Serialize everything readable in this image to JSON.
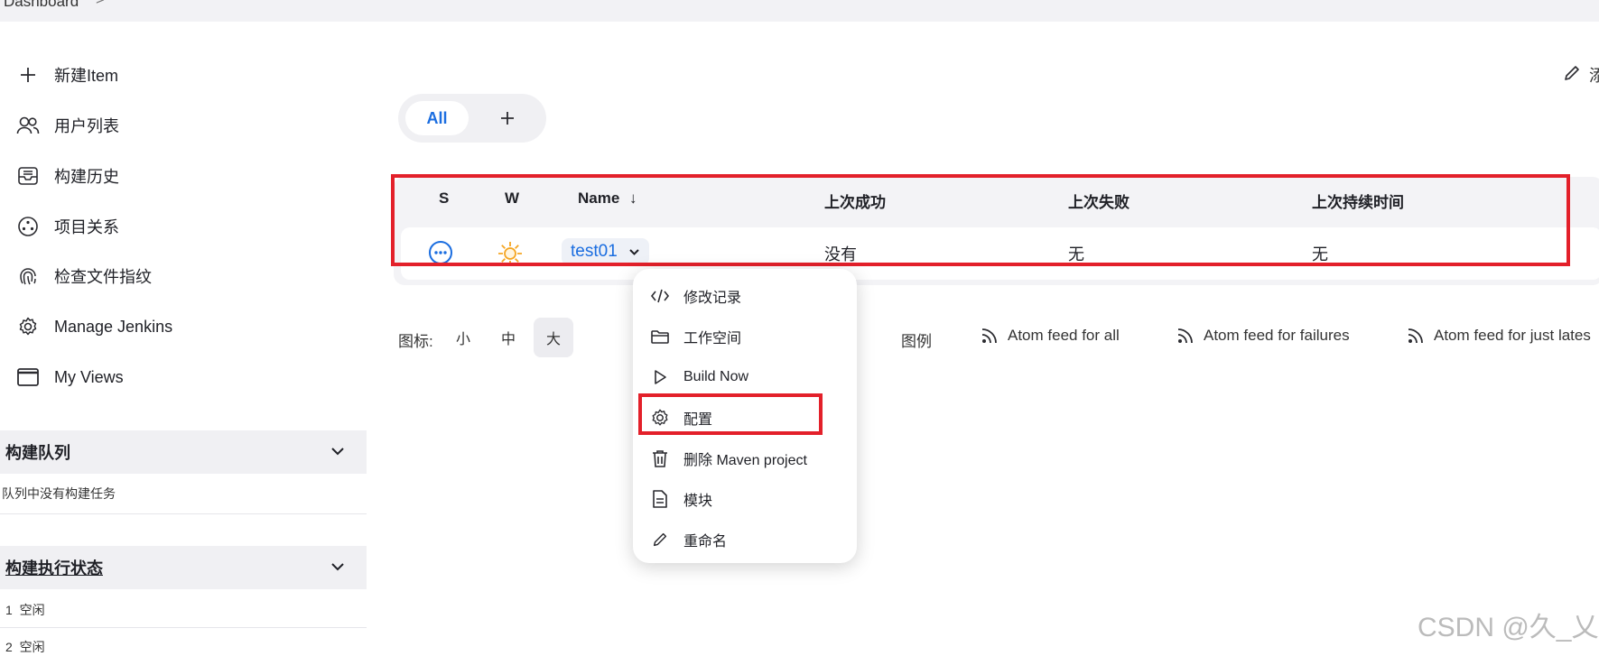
{
  "breadcrumb": {
    "items": [
      "Dashboard"
    ],
    "separator": ">"
  },
  "sidebar": {
    "items": [
      {
        "label": "新建Item",
        "icon": "plus-icon"
      },
      {
        "label": "用户列表",
        "icon": "users-icon"
      },
      {
        "label": "构建历史",
        "icon": "inbox-icon"
      },
      {
        "label": "项目关系",
        "icon": "relation-icon"
      },
      {
        "label": "检查文件指纹",
        "icon": "fingerprint-icon"
      },
      {
        "label": "Manage Jenkins",
        "icon": "gear-icon"
      },
      {
        "label": "My Views",
        "icon": "window-icon"
      }
    ],
    "build_queue": {
      "title": "构建队列",
      "empty_text": "队列中没有构建任务"
    },
    "executors": {
      "title": "构建执行状态",
      "rows": [
        {
          "num": "1",
          "status": "空闲"
        },
        {
          "num": "2",
          "status": "空闲"
        }
      ]
    }
  },
  "tabs": {
    "items": [
      {
        "label": "All",
        "active": true
      }
    ],
    "add_label": "+"
  },
  "table": {
    "headers": {
      "s": "S",
      "w": "W",
      "name": "Name",
      "sort": "↓",
      "last_success": "上次成功",
      "last_failure": "上次失败",
      "last_duration": "上次持续时间"
    },
    "rows": [
      {
        "name": "test01",
        "last_success": "没有",
        "last_failure": "无",
        "last_duration": "无"
      }
    ]
  },
  "icon_size": {
    "label": "图标:",
    "options": [
      "小",
      "中",
      "大"
    ],
    "selected": "大"
  },
  "legend_label": "图例",
  "feeds": [
    "Atom feed for all",
    "Atom feed for failures",
    "Atom feed for just lates"
  ],
  "context_menu": {
    "items": [
      {
        "label": "修改记录",
        "icon": "code-icon"
      },
      {
        "label": "工作空间",
        "icon": "folder-icon"
      },
      {
        "label": "Build Now",
        "icon": "play-icon"
      },
      {
        "label": "配置",
        "icon": "gear-icon"
      },
      {
        "label": "删除 Maven project",
        "icon": "trash-icon"
      },
      {
        "label": "模块",
        "icon": "document-icon"
      },
      {
        "label": "重命名",
        "icon": "pencil-icon"
      }
    ]
  },
  "top_right": {
    "edit_text": "添"
  },
  "watermark": "CSDN @久_乂",
  "colors": {
    "accent": "#1a6de0",
    "highlight": "#e3202a",
    "weather": "#f5a623"
  }
}
